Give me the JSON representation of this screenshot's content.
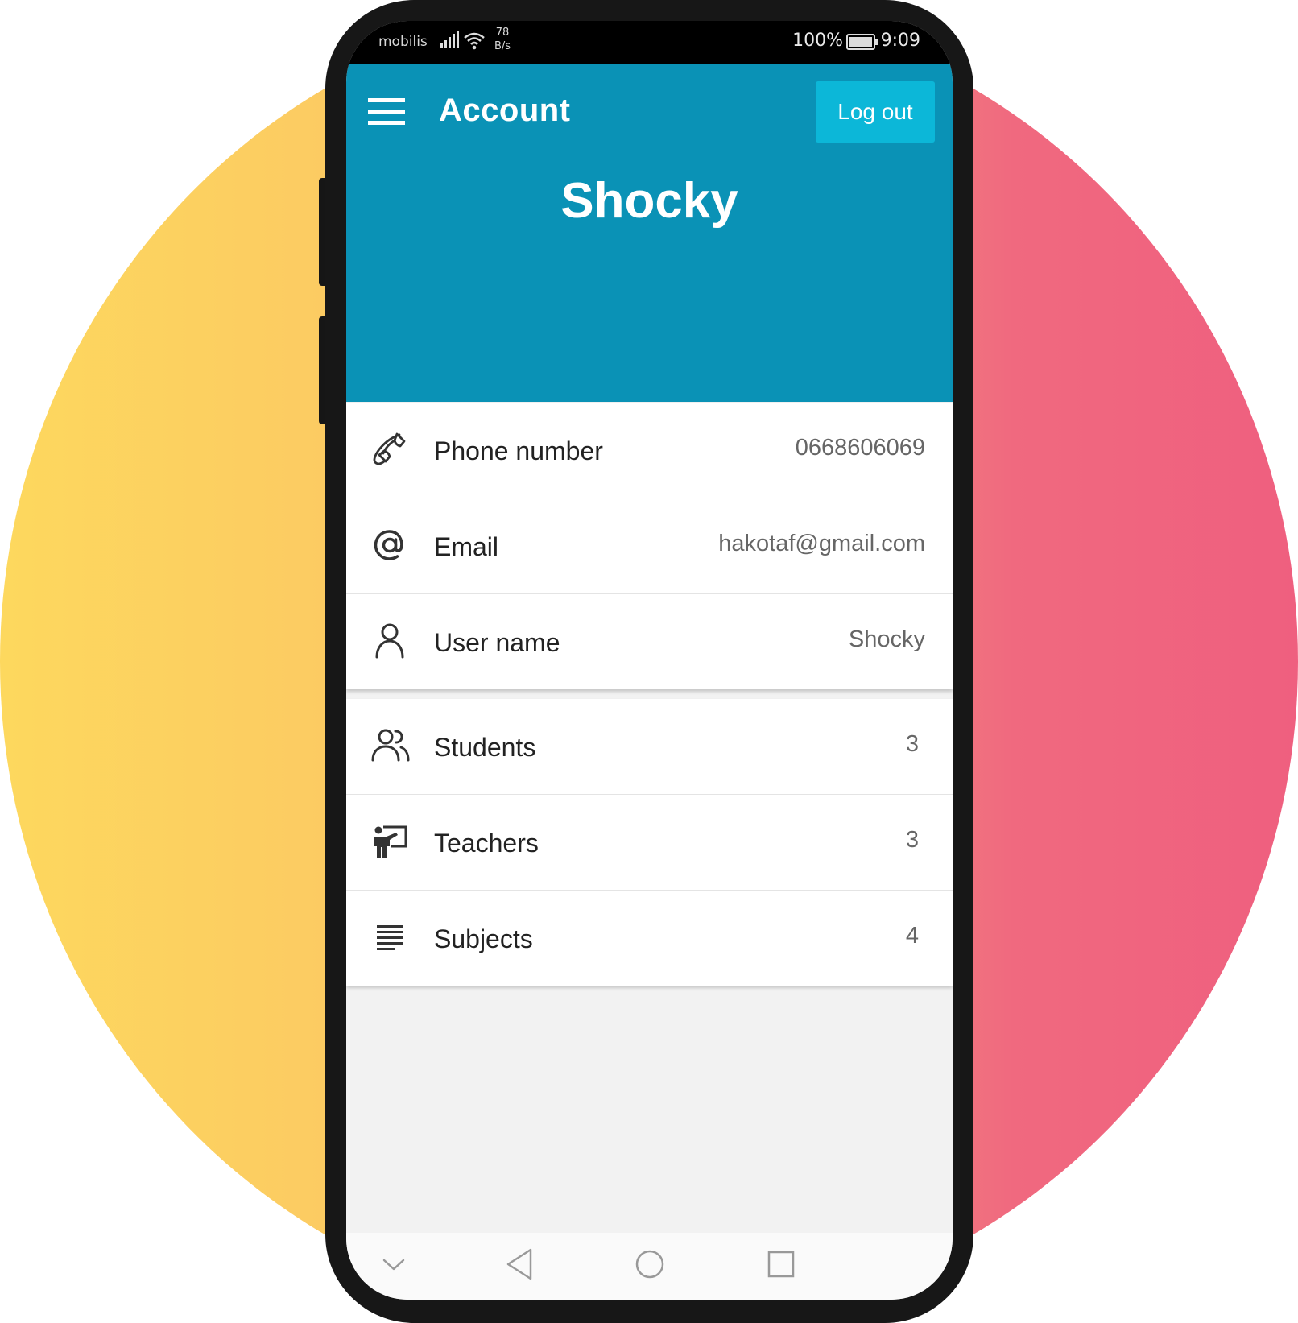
{
  "status_bar": {
    "carrier": "mobilis",
    "net_speed_value": "78",
    "net_speed_unit": "B/s",
    "battery": "100%",
    "time": "9:09"
  },
  "app_bar": {
    "title": "Account",
    "logout_label": "Log out"
  },
  "profile": {
    "name": "Shocky"
  },
  "account_info": [
    {
      "icon": "phone-icon",
      "label": "Phone number",
      "value": "0668606069"
    },
    {
      "icon": "at-sign-icon",
      "label": "Email",
      "value": "hakotaf@gmail.com"
    },
    {
      "icon": "person-icon",
      "label": "User name",
      "value": "Shocky"
    }
  ],
  "stats": [
    {
      "icon": "users-icon",
      "label": "Students",
      "value": "3"
    },
    {
      "icon": "teacher-board-icon",
      "label": "Teachers",
      "value": "3"
    },
    {
      "icon": "list-lines-icon",
      "label": "Subjects",
      "value": "4"
    }
  ],
  "colors": {
    "primary": "#0a92b6",
    "accent": "#0cb7d8",
    "background": "#f2f2f2"
  }
}
